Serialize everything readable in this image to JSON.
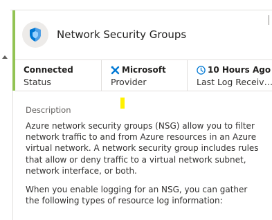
{
  "panel": {
    "title": "Network Security Groups",
    "icon": "shield-icon",
    "accent_color": "#92c353"
  },
  "info": {
    "status": {
      "value": "Connected",
      "label": "Status"
    },
    "provider": {
      "value": "Microsoft",
      "label": "Provider",
      "icon": "microsoft-tools-icon"
    },
    "last_log": {
      "value": "10 Hours Ago",
      "label": "Last Log Received",
      "icon": "clock-icon"
    }
  },
  "description": {
    "heading": "Description",
    "paragraphs": [
      "Azure network security groups (NSG) allow you to filter network traffic to and from Azure resources in an Azure virtual network. A network security group includes rules that allow or deny traffic to a virtual network subnet, network interface, or both.",
      "When you enable logging for an NSG, you can gather the following types of resource log information:"
    ]
  }
}
